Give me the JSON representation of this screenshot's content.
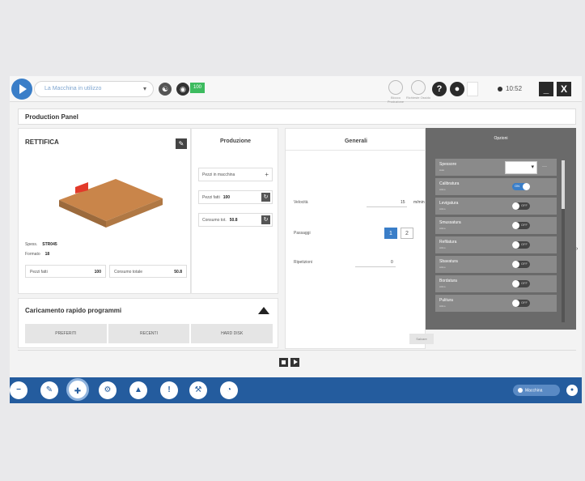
{
  "topbar": {
    "machine_selector": "La Macchina in utilizzo",
    "badge": "100",
    "circle1_label": "Blocco Produzione",
    "circle2_label": "Richieste Ossido",
    "help_glyph": "?",
    "clock": "10:52",
    "minimize_glyph": "_",
    "close_glyph": "X"
  },
  "title": "Production Panel",
  "rettifica": {
    "title": "RETTIFICA",
    "spessore_label": "Spess.",
    "spessore_value": "STR045",
    "formato_label": "Formato",
    "formato_value": "18",
    "pezzi_label": "Pezzi fatti",
    "pezzi_value": "100",
    "consumo_label": "Consumo totale",
    "consumo_value": "50.8"
  },
  "produzione": {
    "title": "Produzione",
    "field1_label": "Pezzi in macchina",
    "field2_label": "Pezzi fatti",
    "field2_value": "100",
    "field3_label": "Consumo tot.",
    "field3_value": "50.8"
  },
  "caricamento": {
    "title": "Caricamento rapido programmi",
    "buttons": [
      "PREFERITI",
      "RECENTI",
      "HARD DISK"
    ]
  },
  "generali": {
    "title": "Generali",
    "row1_label": "Velocità",
    "row1_value": "15",
    "row1_unit": "m/min",
    "row2_label": "Passaggi",
    "row2_opt1": "1",
    "row2_opt2": "2",
    "row3_label": "Ripetizioni",
    "row3_value": "0",
    "save_label": "Salvare"
  },
  "opzioni": {
    "title": "Opzioni",
    "rows": [
      {
        "name": "Spessore",
        "sub": "Auto",
        "control": "select"
      },
      {
        "name": "Calibratura",
        "sub": "Attivo",
        "control": "on",
        "state": "ON"
      },
      {
        "name": "Levigatura",
        "sub": "Attivo",
        "control": "off",
        "state": "OFF"
      },
      {
        "name": "Smussatura",
        "sub": "Attivo",
        "control": "off",
        "state": "OFF"
      },
      {
        "name": "Refilatura",
        "sub": "Attivo",
        "control": "off",
        "state": "OFF"
      },
      {
        "name": "Sbavatura",
        "sub": "Attivo",
        "control": "off",
        "state": "OFF"
      },
      {
        "name": "Bordatura",
        "sub": "Attivo",
        "control": "off",
        "state": "OFF"
      },
      {
        "name": "Pulitura",
        "sub": "Attivo",
        "control": "off",
        "state": "OFF"
      }
    ]
  },
  "bottombar": {
    "machine_label": "Macchina",
    "icon_glyphs": [
      "−",
      "✎",
      "✚",
      "⚙",
      "▲",
      "!",
      "⚒",
      "◔"
    ]
  }
}
